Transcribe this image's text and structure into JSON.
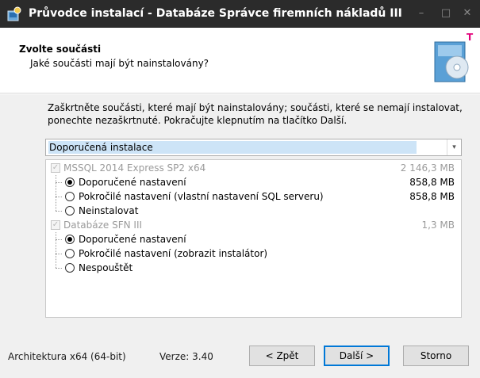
{
  "window": {
    "title": "Průvodce instalací - Databáze Správce firemních nákladů III",
    "controls": {
      "minimize": "–",
      "maximize": "□",
      "close": "✕"
    }
  },
  "header": {
    "title": "Zvolte součásti",
    "subtitle": "Jaké součásti mají být nainstalovány?"
  },
  "content": {
    "description": "Zaškrtněte součásti, které mají být nainstalovány; součásti, které se nemají instalovat, ponechte nezaškrtnuté. Pokračujte klepnutím na tlačítko Další.",
    "install_type": "Doporučená instalace",
    "components": [
      {
        "label": "MSSQL 2014 Express SP2 x64",
        "size": "2 146,3 MB",
        "checked": true,
        "disabled": true,
        "options": [
          {
            "label": "Doporučené nastavení",
            "size": "858,8 MB",
            "selected": true
          },
          {
            "label": "Pokročilé nastavení (vlastní nastavení SQL serveru)",
            "size": "858,8 MB",
            "selected": false
          },
          {
            "label": "Neinstalovat",
            "size": "",
            "selected": false
          }
        ]
      },
      {
        "label": "Databáze SFN III",
        "size": "1,3 MB",
        "checked": true,
        "disabled": true,
        "options": [
          {
            "label": "Doporučené nastavení",
            "size": "",
            "selected": true
          },
          {
            "label": "Pokročilé nastavení (zobrazit instalátor)",
            "size": "",
            "selected": false
          },
          {
            "label": "Nespouštět",
            "size": "",
            "selected": false
          }
        ]
      }
    ]
  },
  "footer": {
    "architecture": "Architektura x64 (64-bit)",
    "version": "Verze: 3.40",
    "back_label": "< Zpět",
    "next_label": "Další >",
    "cancel_label": "Storno"
  },
  "colors": {
    "titlebar": "#2b2b2b",
    "accent": "#0078d7",
    "selection": "#cde4f7",
    "disabled_text": "#9b9b9b"
  }
}
